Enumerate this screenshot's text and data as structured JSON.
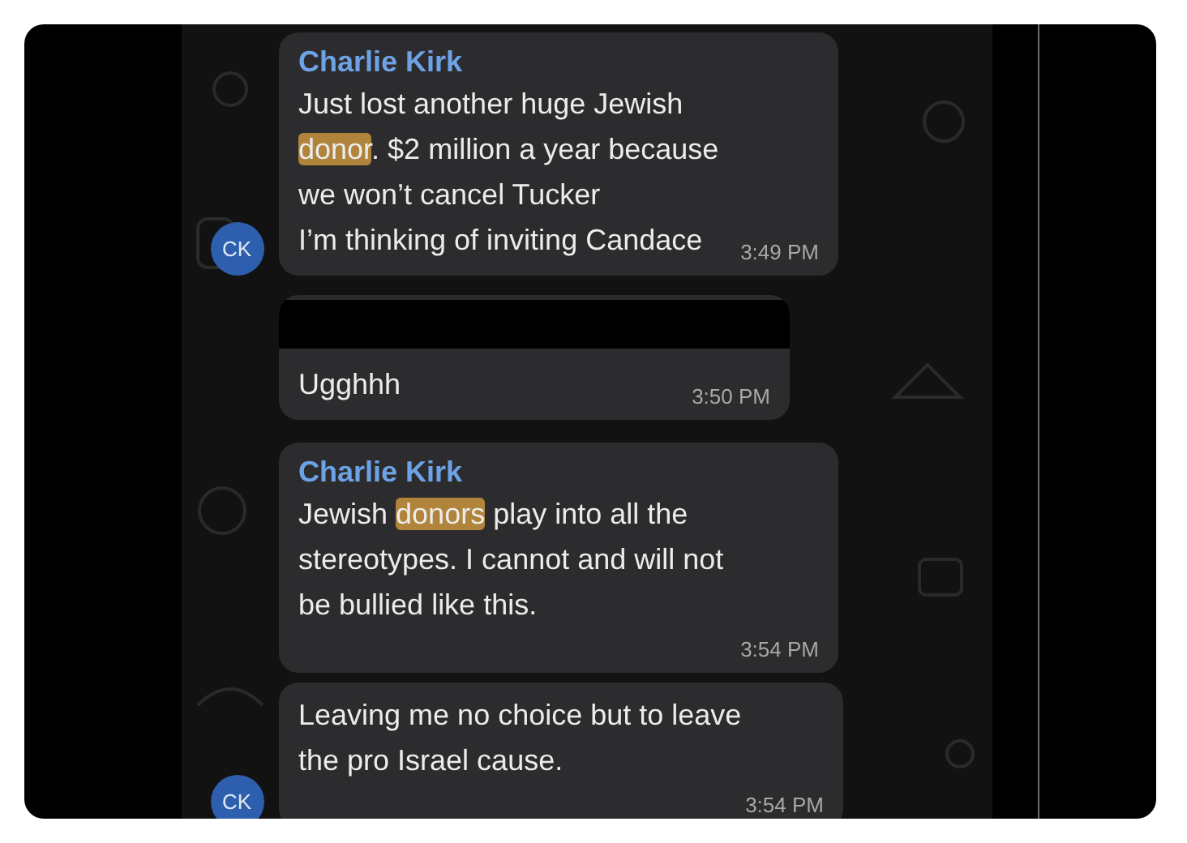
{
  "messages": [
    {
      "sender": "Charlie Kirk",
      "segments": [
        {
          "text": "Just lost another huge Jewish\n",
          "highlighted": false
        },
        {
          "text": "donor",
          "highlighted": true
        },
        {
          "text": ". $2 million a year because\nwe won’t cancel Tucker\nI’m thinking of inviting Candace",
          "highlighted": false
        }
      ],
      "time": "3:49 PM",
      "avatar": "CK",
      "redacted": false
    },
    {
      "segments": [
        {
          "text": "Ugghhh",
          "highlighted": false
        }
      ],
      "time": "3:50 PM",
      "redacted": true
    },
    {
      "sender": "Charlie Kirk",
      "segments": [
        {
          "text": "Jewish ",
          "highlighted": false
        },
        {
          "text": "donors",
          "highlighted": true
        },
        {
          "text": " play into all the\nstereotypes. I cannot and will not\nbe bullied like this.",
          "highlighted": false
        }
      ],
      "time": "3:54 PM",
      "redacted": false
    },
    {
      "segments": [
        {
          "text": "Leaving me no choice but to leave\nthe pro Israel cause.",
          "highlighted": false
        }
      ],
      "time": "3:54 PM",
      "avatar": "CK",
      "redacted": false
    }
  ]
}
